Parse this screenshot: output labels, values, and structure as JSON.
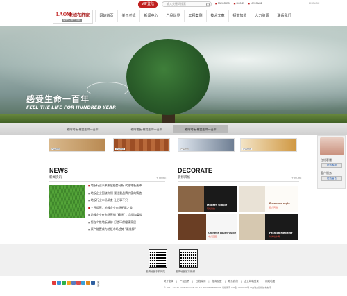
{
  "topbar": {
    "vip_label": "VIP登陆",
    "search_placeholder": "输入关键词搜索",
    "links": [
      "FAVORIES",
      "HOME",
      "MESSAGE"
    ],
    "english": "ENGLISH"
  },
  "logo": {
    "brand": "LAOM",
    "cn": "老姆布舒家",
    "sub": "感受生命一百年"
  },
  "nav": [
    "网站首页",
    "关于老姆",
    "新闻中心",
    "产品世界",
    "工程案例",
    "技术文章",
    "招商加盟",
    "人力资源",
    "联系我们"
  ],
  "banner": {
    "slogan_cn": "感受生命一百年",
    "slogan_en": "FEEL THE LIFE FOR HUNDRED YEAR"
  },
  "tabs": [
    "老姆地板-感受生命一百年",
    "老姆地板-感受生命一百年",
    "老姆地板-感受生命一百年"
  ],
  "products": [
    "产品世界",
    "产品世界",
    "产品世界",
    "产品世界"
  ],
  "sidepanel": {
    "online": "在线客服",
    "btn1": "在线客服",
    "service": "客户服务",
    "btn2": "在线留言"
  },
  "news": {
    "heading": "NEWS",
    "sub": "新闻快讯",
    "more": "+ MORE",
    "items": [
      "地板行业未来发展趋势分析 代理地板选择",
      "地板企业围绕你们 要注重品牌价值的铸造",
      "地板行业市场调查 让后事不只",
      "三元运营：地板企业市场拓展之道",
      "地板企业在市场营销 \"精耕\" ：品牌和渠道",
      "您在个性地板装修 打造环保健康家居",
      "康产能置成为地板市场趋势 \"最佳解\""
    ]
  },
  "decorate": {
    "heading": "DECORATE",
    "sub": "装修风格",
    "more": "+ MORE",
    "items": [
      {
        "en": "Modern simple",
        "cn": "现代简约"
      },
      {
        "en": "European style",
        "cn": "欧式风格"
      },
      {
        "en": "Chinese countryside",
        "cn": "中式田园"
      },
      {
        "en": "Fashion Mediterr",
        "cn": "时尚地中海"
      }
    ]
  },
  "footer": {
    "qr1": "老姆地板手机网站",
    "qr2": "老姆地板官方微博",
    "share_label": "更多",
    "links": [
      "关于老姆",
      "产品世界",
      "工程案例",
      "招商加盟",
      "联系我们",
      "企业邮箱登录",
      "网站地图"
    ],
    "copyright": "© 2011-2012 LAOMSHU.COM.CN ALL RIGHT RESERVED  版权所有  ICP备12000000号  中企动力提供技术支持"
  },
  "colors": {
    "accent": "#c0201f",
    "banner_green": "#4e6a55",
    "footer_bg": "#f0f0f0"
  }
}
